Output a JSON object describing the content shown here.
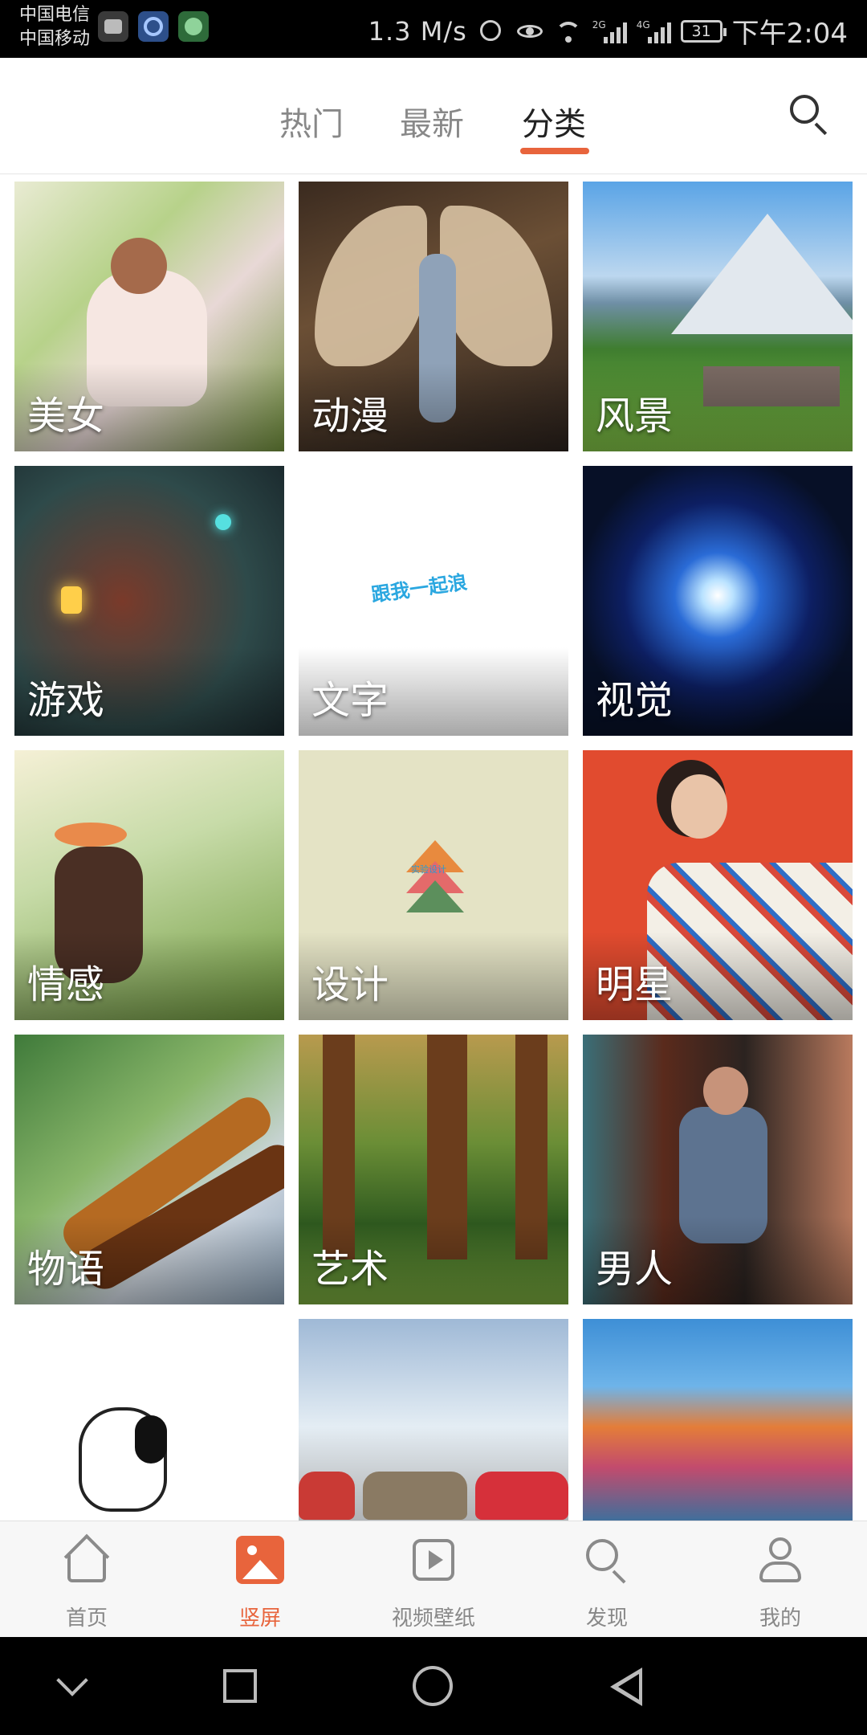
{
  "status_bar": {
    "carrier_1": "中国电信",
    "carrier_2": "中国移动",
    "network_speed": "1.3 M/s",
    "signal_1_label": "2G",
    "signal_2_label": "4G",
    "battery_level": "31",
    "time": "下午2:04",
    "icons": [
      "app-icon-1",
      "app-icon-2",
      "app-icon-3",
      "alarm-icon",
      "eye-icon",
      "wifi-icon",
      "signal-icon",
      "signal-icon",
      "battery-icon"
    ]
  },
  "top_tabs": {
    "tabs": [
      {
        "label": "热门",
        "active": false
      },
      {
        "label": "最新",
        "active": false
      },
      {
        "label": "分类",
        "active": true
      }
    ],
    "search_icon": "search-icon",
    "accent_color": "#e8643c"
  },
  "categories": [
    {
      "label": "美女",
      "art": "beauty"
    },
    {
      "label": "动漫",
      "art": "anime"
    },
    {
      "label": "风景",
      "art": "landscape"
    },
    {
      "label": "游戏",
      "art": "game"
    },
    {
      "label": "文字",
      "art": "text",
      "image_text": "跟我一起浪"
    },
    {
      "label": "视觉",
      "art": "visual"
    },
    {
      "label": "情感",
      "art": "emotion"
    },
    {
      "label": "设计",
      "art": "design",
      "image_text": "实验设计"
    },
    {
      "label": "明星",
      "art": "star"
    },
    {
      "label": "物语",
      "art": "story"
    },
    {
      "label": "艺术",
      "art": "art"
    },
    {
      "label": "男人",
      "art": "man"
    },
    {
      "label": "",
      "art": "snoopy"
    },
    {
      "label": "",
      "art": "car"
    },
    {
      "label": "",
      "art": "coast"
    }
  ],
  "bottom_nav": {
    "items": [
      {
        "label": "首页",
        "icon": "home-icon",
        "active": false
      },
      {
        "label": "竖屏",
        "icon": "portrait-wallpaper-icon",
        "active": true
      },
      {
        "label": "视频壁纸",
        "icon": "video-play-icon",
        "active": false
      },
      {
        "label": "发现",
        "icon": "discover-icon",
        "active": false
      },
      {
        "label": "我的",
        "icon": "profile-icon",
        "active": false
      }
    ]
  },
  "system_nav": {
    "buttons": [
      "collapse-icon",
      "recents-square-icon",
      "home-circle-icon",
      "back-triangle-icon"
    ]
  }
}
